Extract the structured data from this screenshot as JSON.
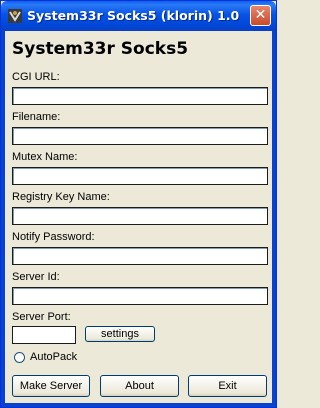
{
  "window": {
    "title": "System33r Socks5 (klorin) 1.0",
    "close_symbol": "✕",
    "icon": "app-logo-icon"
  },
  "heading": "System33r Socks5",
  "fields": [
    {
      "label": "CGI URL:",
      "value": ""
    },
    {
      "label": "Filename:",
      "value": ""
    },
    {
      "label": "Mutex Name:",
      "value": ""
    },
    {
      "label": "Registry Key Name:",
      "value": ""
    },
    {
      "label": "Notify Password:",
      "value": ""
    },
    {
      "label": "Server Id:",
      "value": ""
    }
  ],
  "server_port": {
    "label": "Server Port:",
    "value": ""
  },
  "settings_button": "settings",
  "autopack": {
    "label": "AutoPack",
    "checked": false
  },
  "buttons": {
    "make_server": "Make Server",
    "about": "About",
    "exit": "Exit"
  },
  "colors": {
    "titlebar": "#0653e6",
    "window_bg": "#ece9d8",
    "close": "#c94a2c"
  }
}
